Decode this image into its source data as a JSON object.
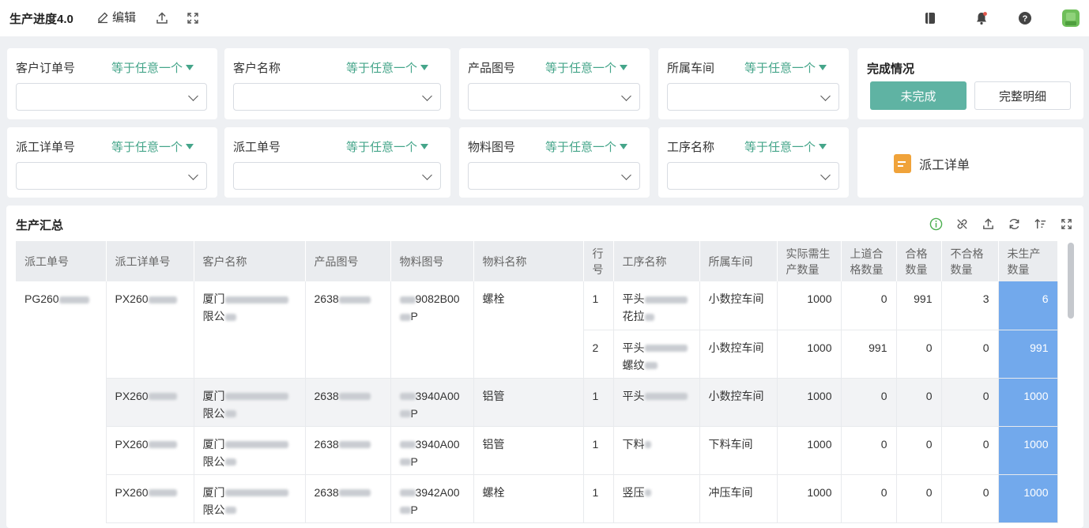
{
  "header": {
    "title": "生产进度4.0",
    "edit_label": "编辑",
    "icons": [
      "edit-icon",
      "export-icon",
      "fullscreen-icon",
      "book-icon",
      "bell-icon",
      "help-icon",
      "avatar"
    ]
  },
  "filters_row1": [
    {
      "label": "客户订单号",
      "op": "等于任意一个"
    },
    {
      "label": "客户名称",
      "op": "等于任意一个"
    },
    {
      "label": "产品图号",
      "op": "等于任意一个"
    },
    {
      "label": "所属车间",
      "op": "等于任意一个"
    }
  ],
  "filters_row2": [
    {
      "label": "派工详单号",
      "op": "等于任意一个"
    },
    {
      "label": "派工单号",
      "op": "等于任意一个"
    },
    {
      "label": "物料图号",
      "op": "等于任意一个"
    },
    {
      "label": "工序名称",
      "op": "等于任意一个"
    }
  ],
  "status": {
    "title": "完成情况",
    "primary_label": "未完成",
    "secondary_label": "完整明细"
  },
  "detail_link": {
    "label": "派工详单"
  },
  "summary": {
    "title": "生产汇总",
    "icons": [
      "info-icon",
      "link-icon",
      "export-icon",
      "refresh-icon",
      "sort-icon",
      "fullscreen-icon"
    ],
    "columns": [
      "派工单号",
      "派工详单号",
      "客户名称",
      "产品图号",
      "物料图号",
      "物料名称",
      "行号",
      "工序名称",
      "所属车间",
      "实际需生产数量",
      "上道合格数量",
      "合格数量",
      "不合格数量",
      "未生产数量"
    ],
    "rows": [
      {
        "order": "PG260",
        "detail": "PX260",
        "customer": "厦门",
        "customer2": "限公",
        "product": "2638",
        "material": "9082B00",
        "material2": "P",
        "mat_name": "螺栓",
        "line": "1",
        "process": "平头",
        "process2": "花拉",
        "workshop": "小数控车间",
        "need": "1000",
        "prev_ok": "0",
        "ok": "991",
        "ng": "3",
        "remain": "6"
      },
      {
        "order": "",
        "detail": "",
        "customer": "",
        "customer2": "",
        "product": "",
        "material": "",
        "material2": "",
        "mat_name": "",
        "line": "2",
        "process": "平头",
        "process2": "螺纹",
        "workshop": "小数控车间",
        "need": "1000",
        "prev_ok": "991",
        "ok": "0",
        "ng": "0",
        "remain": "991"
      },
      {
        "order": "",
        "detail": "PX260",
        "customer": "厦门",
        "customer2": "限公",
        "product": "2638",
        "material": "3940A00",
        "material2": "P",
        "mat_name": "铝管",
        "line": "1",
        "process": "平头",
        "process2": "",
        "workshop": "小数控车间",
        "need": "1000",
        "prev_ok": "0",
        "ok": "0",
        "ng": "0",
        "remain": "1000"
      },
      {
        "order": "",
        "detail": "PX260",
        "customer": "厦门",
        "customer2": "限公",
        "product": "2638",
        "material": "3940A00",
        "material2": "P",
        "mat_name": "铝管",
        "line": "1",
        "process": "下料",
        "process2": "",
        "workshop": "下料车间",
        "need": "1000",
        "prev_ok": "0",
        "ok": "0",
        "ng": "0",
        "remain": "1000"
      },
      {
        "order": "",
        "detail": "PX260",
        "customer": "厦门",
        "customer2": "限公",
        "product": "2638",
        "material": "3942A00",
        "material2": "P",
        "mat_name": "螺栓",
        "line": "1",
        "process": "竖压",
        "process2": "",
        "workshop": "冲压车间",
        "need": "1000",
        "prev_ok": "0",
        "ok": "0",
        "ng": "0",
        "remain": "1000"
      }
    ]
  },
  "colors": {
    "accent": "#45a58a",
    "primary_btn": "#5fb3a3",
    "highlight_col": "#72a9ec"
  }
}
